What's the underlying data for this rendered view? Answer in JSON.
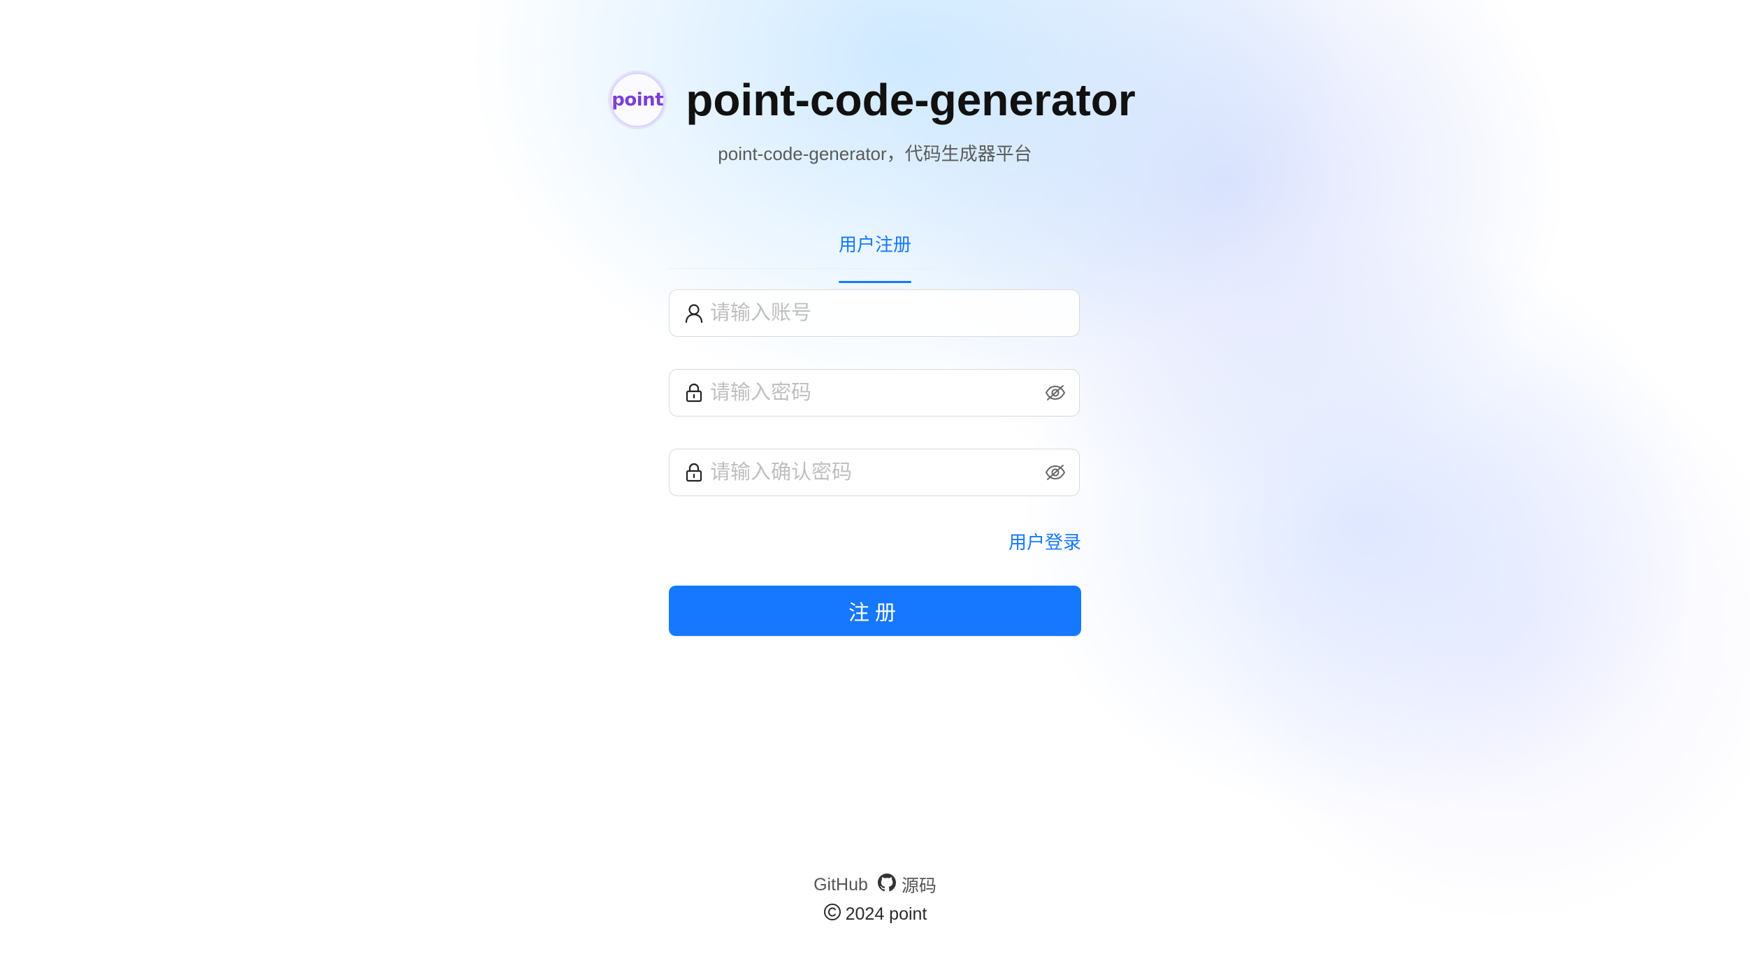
{
  "brand": {
    "logo_text": "point",
    "title": "point-code-generator",
    "subtitle": "point-code-generator，代码生成器平台"
  },
  "tabs": [
    {
      "label": "用户注册",
      "active": true
    }
  ],
  "form": {
    "account_placeholder": "请输入账号",
    "password_placeholder": "请输入密码",
    "confirm_password_placeholder": "请输入确认密码",
    "login_link_label": "用户登录",
    "submit_label": "注册"
  },
  "icons": {
    "account": "user-icon",
    "password": "lock-icon",
    "password_visibility": "eye-invisible-icon",
    "github": "github-icon",
    "copyright": "copyright-icon"
  },
  "footer": {
    "github_label": "GitHub",
    "source_label": "源码",
    "copyright_text": "2024 point"
  },
  "colors": {
    "primary": "#1677ff",
    "logo": "#7b3fd6",
    "title": "#111111",
    "placeholder": "#bfbfbf"
  }
}
